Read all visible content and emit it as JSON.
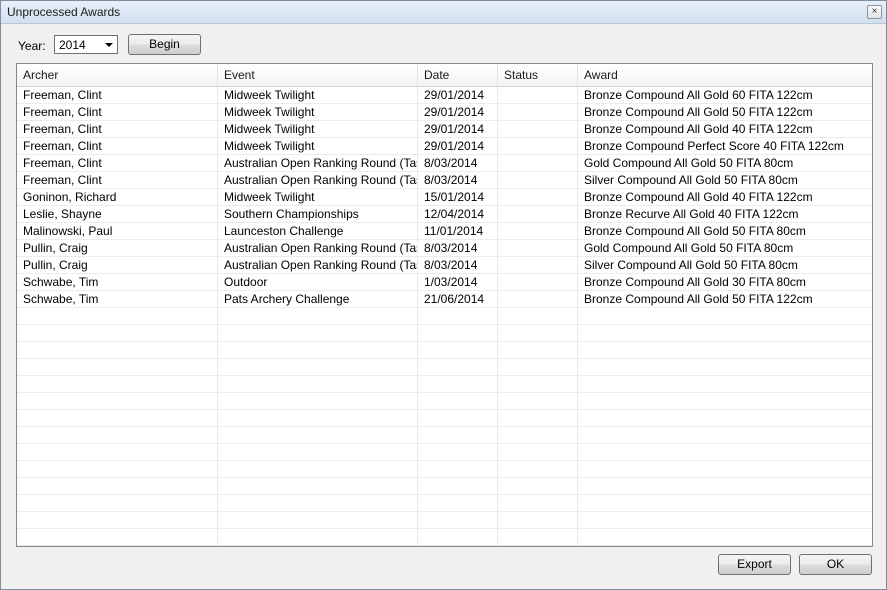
{
  "window": {
    "title": "Unprocessed Awards",
    "close_glyph": "×"
  },
  "toolbar": {
    "year_label": "Year:",
    "year_value": "2014",
    "begin_label": "Begin"
  },
  "table": {
    "columns": [
      "Archer",
      "Event",
      "Date",
      "Status",
      "Award"
    ],
    "rows": [
      [
        "Freeman, Clint",
        "Midweek Twilight",
        "29/01/2014",
        "",
        "Bronze Compound All Gold 60 FITA 122cm"
      ],
      [
        "Freeman, Clint",
        "Midweek Twilight",
        "29/01/2014",
        "",
        "Bronze Compound All Gold 50 FITA 122cm"
      ],
      [
        "Freeman, Clint",
        "Midweek Twilight",
        "29/01/2014",
        "",
        "Bronze Compound All Gold 40 FITA 122cm"
      ],
      [
        "Freeman, Clint",
        "Midweek Twilight",
        "29/01/2014",
        "",
        "Bronze Compound Perfect Score 40 FITA 122cm"
      ],
      [
        "Freeman, Clint",
        "Australian Open Ranking Round (Tas...",
        "8/03/2014",
        "",
        "Gold Compound All Gold 50 FITA 80cm"
      ],
      [
        "Freeman, Clint",
        "Australian Open Ranking Round (Tas...",
        "8/03/2014",
        "",
        "Silver Compound All Gold 50 FITA 80cm"
      ],
      [
        "Goninon, Richard",
        "Midweek Twilight",
        "15/01/2014",
        "",
        "Bronze Compound All Gold 40 FITA 122cm"
      ],
      [
        "Leslie, Shayne",
        "Southern Championships",
        "12/04/2014",
        "",
        "Bronze Recurve All Gold 40 FITA 122cm"
      ],
      [
        "Malinowski, Paul",
        "Launceston Challenge",
        "11/01/2014",
        "",
        "Bronze Compound All Gold 50 FITA 80cm"
      ],
      [
        "Pullin, Craig",
        "Australian Open Ranking Round (Tas...",
        "8/03/2014",
        "",
        "Gold Compound All Gold 50 FITA 80cm"
      ],
      [
        "Pullin, Craig",
        "Australian Open Ranking Round (Tas...",
        "8/03/2014",
        "",
        "Silver Compound All Gold 50 FITA 80cm"
      ],
      [
        "Schwabe, Tim",
        "Outdoor",
        "1/03/2014",
        "",
        "Bronze Compound All Gold 30 FITA 80cm"
      ],
      [
        "Schwabe, Tim",
        "Pats Archery Challenge",
        "21/06/2014",
        "",
        "Bronze Compound All Gold 50 FITA 122cm"
      ]
    ]
  },
  "footer": {
    "export_label": "Export",
    "ok_label": "OK"
  }
}
